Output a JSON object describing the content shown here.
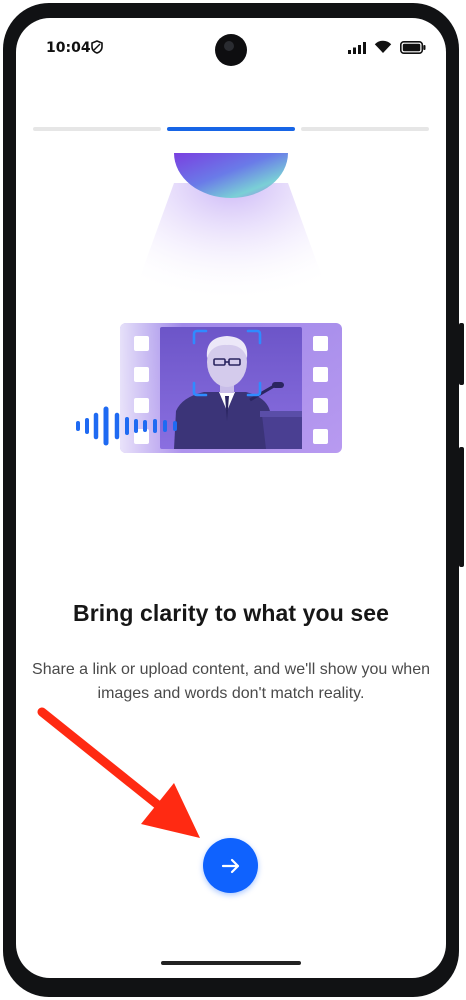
{
  "status_bar": {
    "time": "10:04",
    "icons": [
      "shield-icon",
      "signal-icon",
      "wifi-icon",
      "battery-icon"
    ]
  },
  "onboarding": {
    "progress": {
      "total_steps": 3,
      "current_step": 2
    },
    "illustration": [
      "glow-orb",
      "film-strip",
      "speaker-at-podium",
      "face-detection-frame",
      "audio-waveform"
    ],
    "title": "Bring clarity to what you see",
    "description": "Share a link or upload content, and we'll show you when images and words don't match reality.",
    "next_button": {
      "icon": "arrow-right-icon"
    }
  },
  "annotation": {
    "icon": "red-arrow-pointer",
    "color": "#ff2a12"
  },
  "colors": {
    "accent": "#0f62fe",
    "progress_active": "#1765e6",
    "progress_inactive": "#e6e6e6",
    "illustration_purple": "#9d7fe6"
  }
}
